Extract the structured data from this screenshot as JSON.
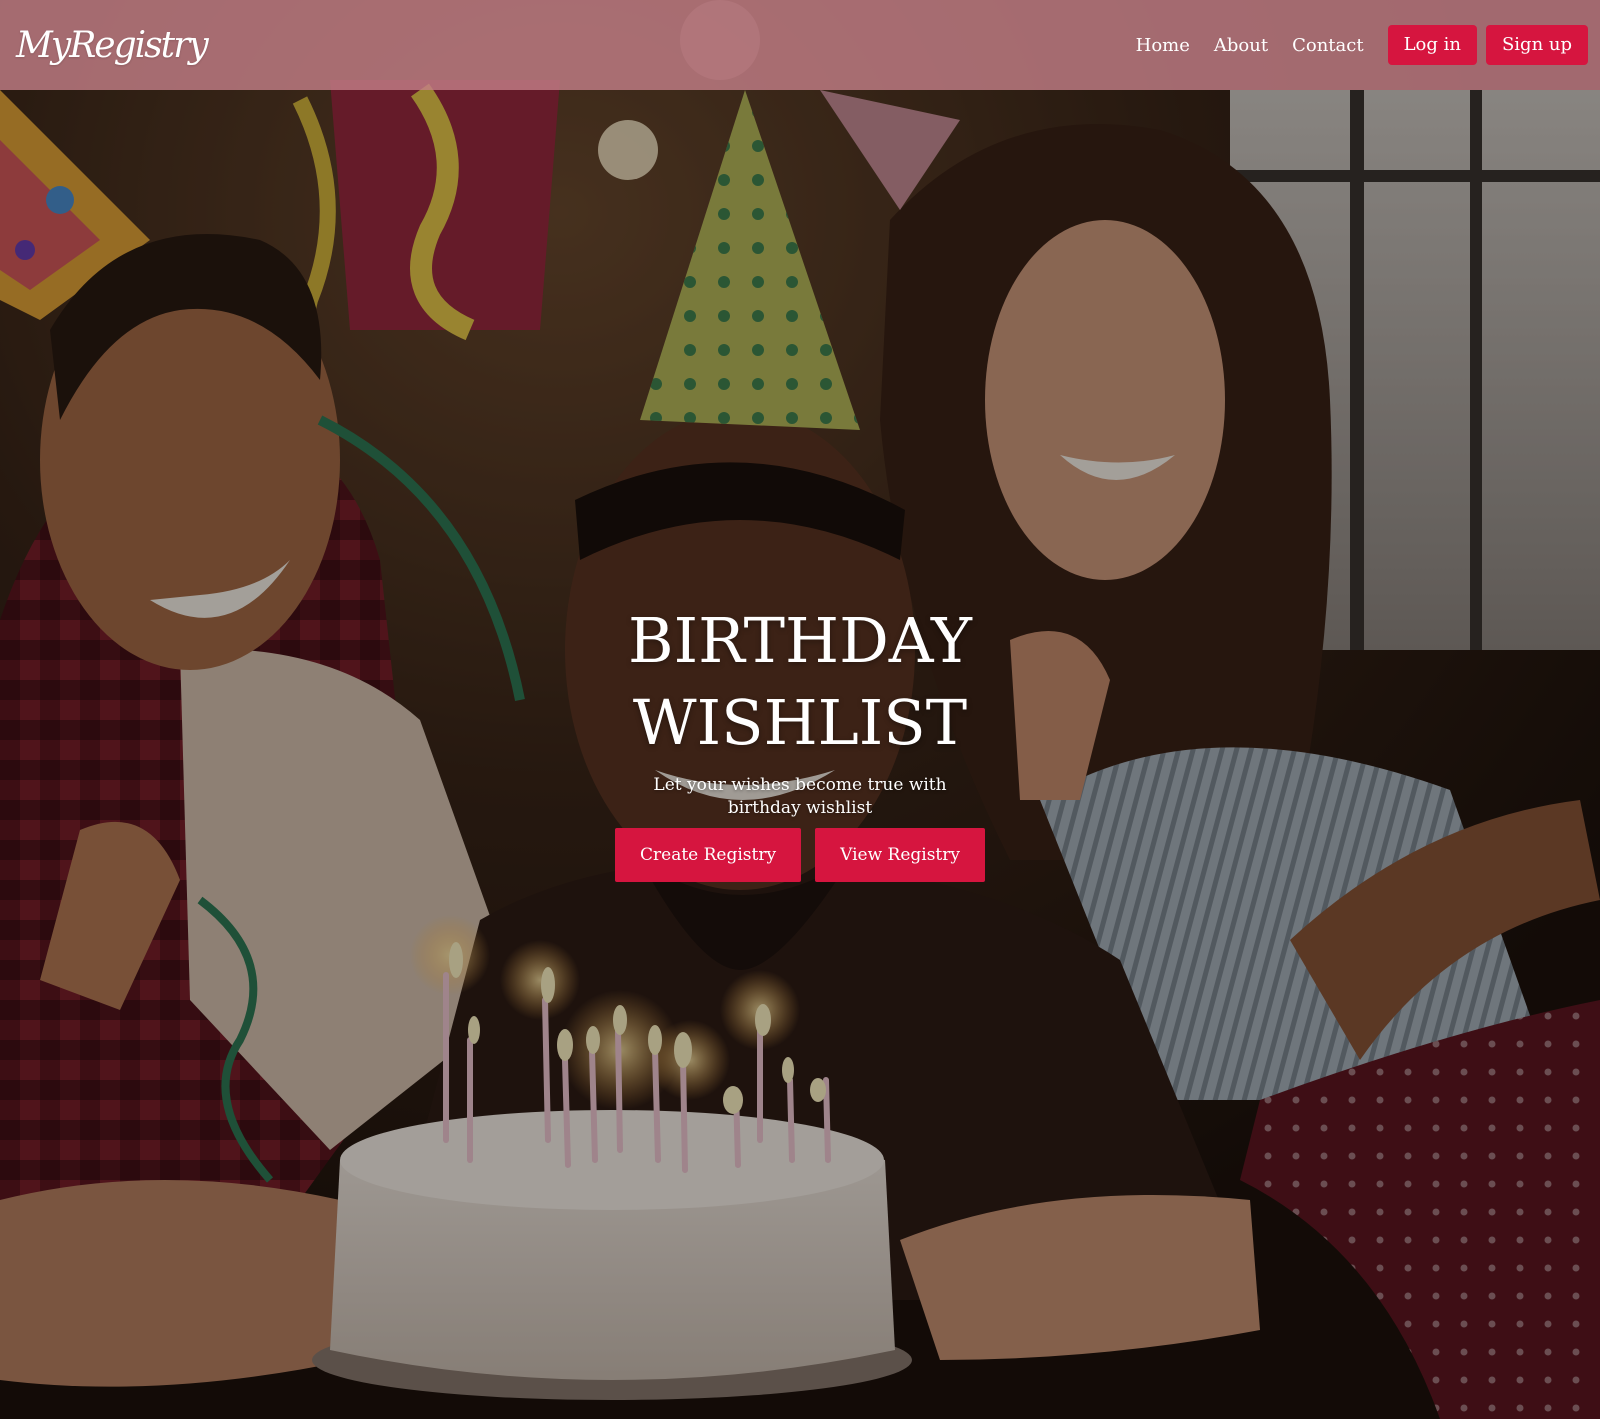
{
  "navbar": {
    "logo": "MyRegistry",
    "links": [
      "Home",
      "About",
      "Contact"
    ],
    "login_label": "Log in",
    "signup_label": "Sign up"
  },
  "hero": {
    "title": "BIRTHDAY WISHLIST",
    "subtitle": "Let your wishes become true with birthday wishlist",
    "buttons": [
      "Create Registry",
      "View Registry"
    ],
    "image_subject": "friends celebrating a birthday around a cake with candles"
  },
  "colors": {
    "accent": "#d6153f",
    "navbar": "#c48088"
  }
}
